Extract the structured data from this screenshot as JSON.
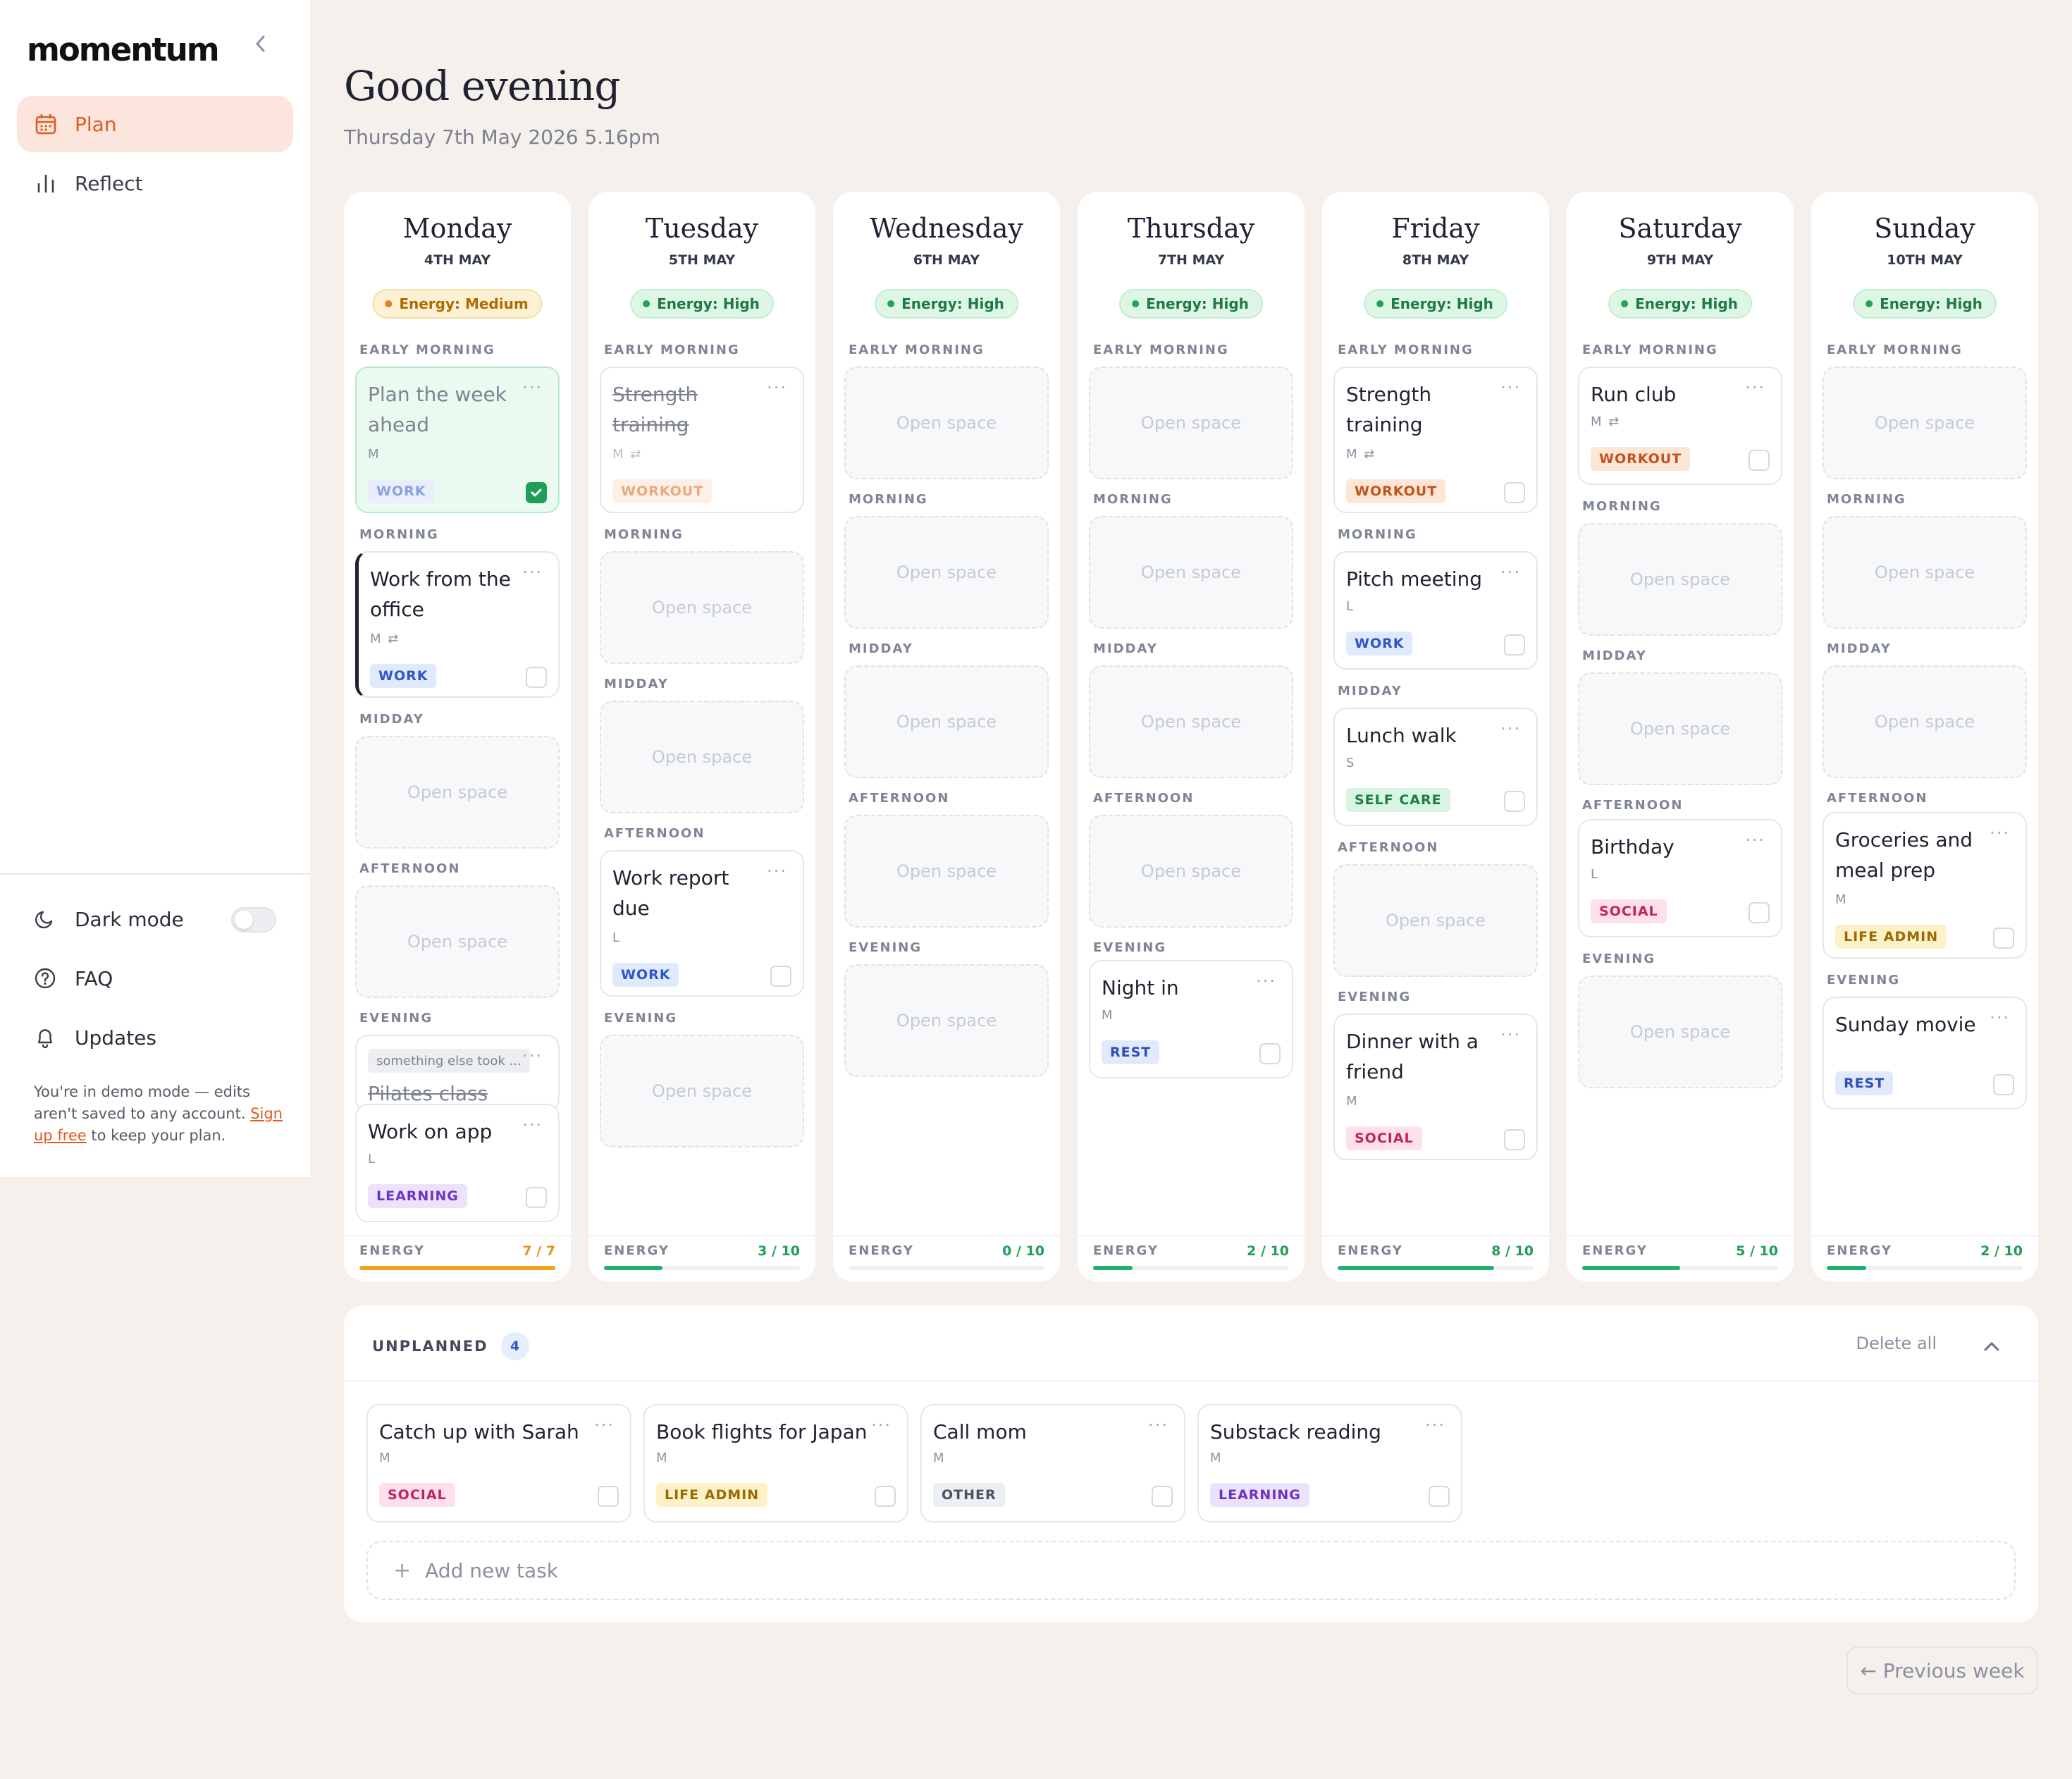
{
  "app": {
    "logo": "momentum"
  },
  "nav": {
    "plan": "Plan",
    "reflect": "Reflect"
  },
  "sidebar_bottom": {
    "dark_mode": "Dark mode",
    "dark_mode_on": false,
    "faq": "FAQ",
    "updates": "Updates",
    "demo_text": "You're in demo mode — edits aren't saved to any account.",
    "signup_link": "Sign up free",
    "demo_suffix": "to keep your plan."
  },
  "header": {
    "greeting": "Good evening",
    "date": "Thursday 7th May 2026 5.16pm"
  },
  "slots": {
    "early_morning": "EARLY MORNING",
    "morning": "MORNING",
    "midday": "MIDDAY",
    "afternoon": "AFTERNOON",
    "evening": "EVENING",
    "open_space": "Open space",
    "energy_label": "ENERGY"
  },
  "days": [
    {
      "name": "Monday",
      "date": "4TH MAY",
      "energy": "Energy: Medium",
      "energy_level": "medium",
      "energy_text": "7 / 7",
      "energy_fraction": 1.0,
      "bar_color": "#f0a21a",
      "value_color": "#e8941a",
      "tasks": [
        {
          "title": "Plan the week ahead",
          "meta": "M",
          "tag": "WORK",
          "done": true
        },
        {
          "title": "Work from the office",
          "meta": "M",
          "tag": "WORK",
          "repeat": true
        },
        {
          "hint": "something else took ...",
          "title_struck": "Pilates class"
        },
        {
          "title": "Work on app",
          "meta": "L",
          "tag": "LEARNING"
        }
      ]
    },
    {
      "name": "Tuesday",
      "date": "5TH MAY",
      "energy": "Energy: High",
      "energy_level": "high",
      "energy_text": "3 / 10",
      "energy_fraction": 0.3,
      "bar_color": "#22b070",
      "value_color": "#1e9e57",
      "tasks": [
        {
          "title": "Strength training",
          "meta": "M",
          "tag": "WORKOUT",
          "skipped": true
        },
        {
          "title": "Work report due",
          "meta": "L",
          "tag": "WORK"
        }
      ]
    },
    {
      "name": "Wednesday",
      "date": "6TH MAY",
      "energy": "Energy: High",
      "energy_level": "high",
      "energy_text": "0 / 10",
      "energy_fraction": 0.0,
      "bar_color": "#22b070",
      "value_color": "#1e9e57",
      "tasks": []
    },
    {
      "name": "Thursday",
      "date": "7TH MAY",
      "energy": "Energy: High",
      "energy_level": "high",
      "energy_text": "2 / 10",
      "energy_fraction": 0.2,
      "bar_color": "#22b070",
      "value_color": "#1e9e57",
      "tasks": [
        {
          "title": "Night in",
          "meta": "M",
          "tag": "REST"
        }
      ]
    },
    {
      "name": "Friday",
      "date": "8TH MAY",
      "energy": "Energy: High",
      "energy_level": "high",
      "energy_text": "8 / 10",
      "energy_fraction": 0.8,
      "bar_color": "#22b070",
      "value_color": "#1e9e57",
      "tasks": [
        {
          "title": "Strength training",
          "meta": "M",
          "tag": "WORKOUT",
          "repeat": true
        },
        {
          "title": "Pitch meeting",
          "meta": "L",
          "tag": "WORK"
        },
        {
          "title": "Lunch walk",
          "meta": "S",
          "tag": "SELF CARE"
        },
        {
          "title": "Dinner with a friend",
          "meta": "M",
          "tag": "SOCIAL"
        }
      ]
    },
    {
      "name": "Saturday",
      "date": "9TH MAY",
      "energy": "Energy: High",
      "energy_level": "high",
      "energy_text": "5 / 10",
      "energy_fraction": 0.5,
      "bar_color": "#22b070",
      "value_color": "#1e9e57",
      "tasks": [
        {
          "title": "Run club",
          "meta": "M",
          "tag": "WORKOUT",
          "repeat": true
        },
        {
          "title": "Birthday",
          "meta": "L",
          "tag": "SOCIAL"
        }
      ]
    },
    {
      "name": "Sunday",
      "date": "10TH MAY",
      "energy": "Energy: High",
      "energy_level": "high",
      "energy_text": "2 / 10",
      "energy_fraction": 0.2,
      "bar_color": "#22b070",
      "value_color": "#1e9e57",
      "tasks": [
        {
          "title": "Groceries and meal prep",
          "meta": "M",
          "tag": "LIFE ADMIN"
        },
        {
          "title": "Sunday movie",
          "meta": "",
          "tag": "REST"
        }
      ]
    }
  ],
  "unplanned": {
    "title": "UNPLANNED",
    "count": "4",
    "delete_all": "Delete all",
    "tasks": [
      {
        "title": "Catch up with Sarah",
        "meta": "M",
        "tag": "SOCIAL"
      },
      {
        "title": "Book flights for Japan",
        "meta": "M",
        "tag": "LIFE ADMIN"
      },
      {
        "title": "Call mom",
        "meta": "M",
        "tag": "OTHER"
      },
      {
        "title": "Substack reading",
        "meta": "M",
        "tag": "LEARNING"
      }
    ],
    "add_task": "Add new task"
  },
  "footer": {
    "previous_week": "← Previous week"
  },
  "icons": {
    "more": "···",
    "collapse": "chevron-left-icon",
    "plan": "calendar-icon",
    "reflect": "bar-chart-icon",
    "dark": "moon-icon",
    "faq": "help-circle-icon",
    "updates": "bell-icon"
  }
}
